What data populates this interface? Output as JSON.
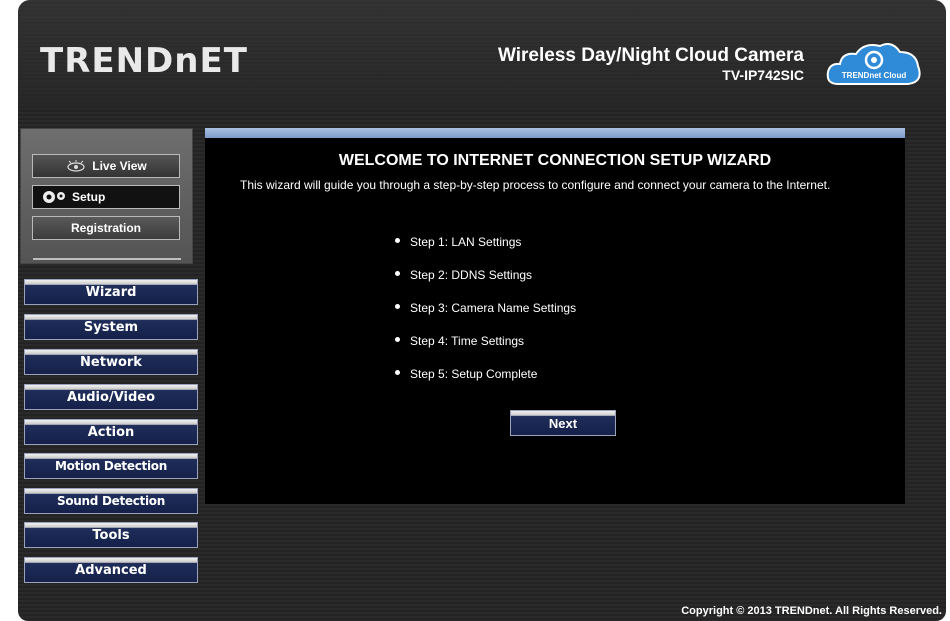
{
  "header": {
    "logo": "TRENDnET",
    "product_title": "Wireless Day/Night Cloud Camera",
    "product_model": "TV-IP742SIC",
    "cloud_badge_label": "TRENDnet Cloud"
  },
  "side_panel": {
    "live_view": "Live View",
    "setup": "Setup",
    "registration": "Registration"
  },
  "menu": {
    "wizard": "Wizard",
    "system": "System",
    "network": "Network",
    "audio_video": "Audio/Video",
    "action": "Action",
    "motion_detection": "Motion Detection",
    "sound_detection": "Sound Detection",
    "tools": "Tools",
    "advanced": "Advanced"
  },
  "main": {
    "title": "WELCOME TO INTERNET CONNECTION SETUP WIZARD",
    "description": "This wizard will guide you through a step-by-step process to configure and connect your camera to the Internet.",
    "steps": [
      "Step 1: LAN Settings",
      "Step 2: DDNS Settings",
      "Step 3: Camera Name Settings",
      "Step 4: Time Settings",
      "Step 5: Setup Complete"
    ],
    "next_label": "Next"
  },
  "footer": {
    "copyright": "Copyright © 2013 TRENDnet. All Rights Reserved."
  },
  "colors": {
    "accent_bar": "#7e9ccd",
    "menu_button": "#152149",
    "panel_bg": "#000000"
  }
}
